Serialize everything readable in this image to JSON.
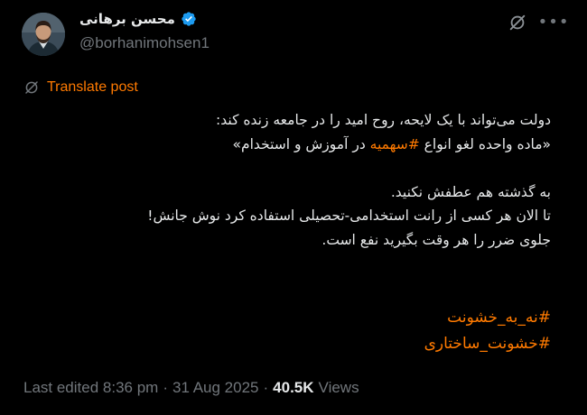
{
  "author": {
    "display_name": "محسن برهانی",
    "handle": "@borhanimohsen1",
    "verified": true
  },
  "translate_label": "Translate post",
  "post": {
    "lines": [
      "دولت می‌تواند با یک لایحه، روح امید را در جامعه زنده کند:",
      "",
      "",
      "به گذشته هم عطفش نکنید.",
      "تا الان هر کسی از رانت استخدامی-تحصیلی استفاده کرد نوش جانش!",
      "جلوی ضرر را هر وقت بگیرید نفع است."
    ],
    "line2_before": "«ماده واحده لغو انواع ",
    "line2_hashtag": "#سهمیه",
    "line2_after": " در آموزش و استخدام»",
    "hashtags": [
      "#نه_به_خشونت",
      "#خشونت_ساختاری"
    ]
  },
  "meta": {
    "edited": "Last edited 8:36 pm",
    "separator": "·",
    "date": "31 Aug 2025",
    "views_count": "40.5K",
    "views_label": "Views"
  },
  "colors": {
    "accent": "#ff7a00",
    "verified_badge": "#1d9bf0",
    "muted": "#71767b",
    "text": "#e7e9ea",
    "background": "#000000"
  },
  "icons": {
    "translate": "translate-globe-slash-icon",
    "grok": "grok-icon",
    "more": "more-options-icon",
    "verified": "verified-badge-icon"
  }
}
